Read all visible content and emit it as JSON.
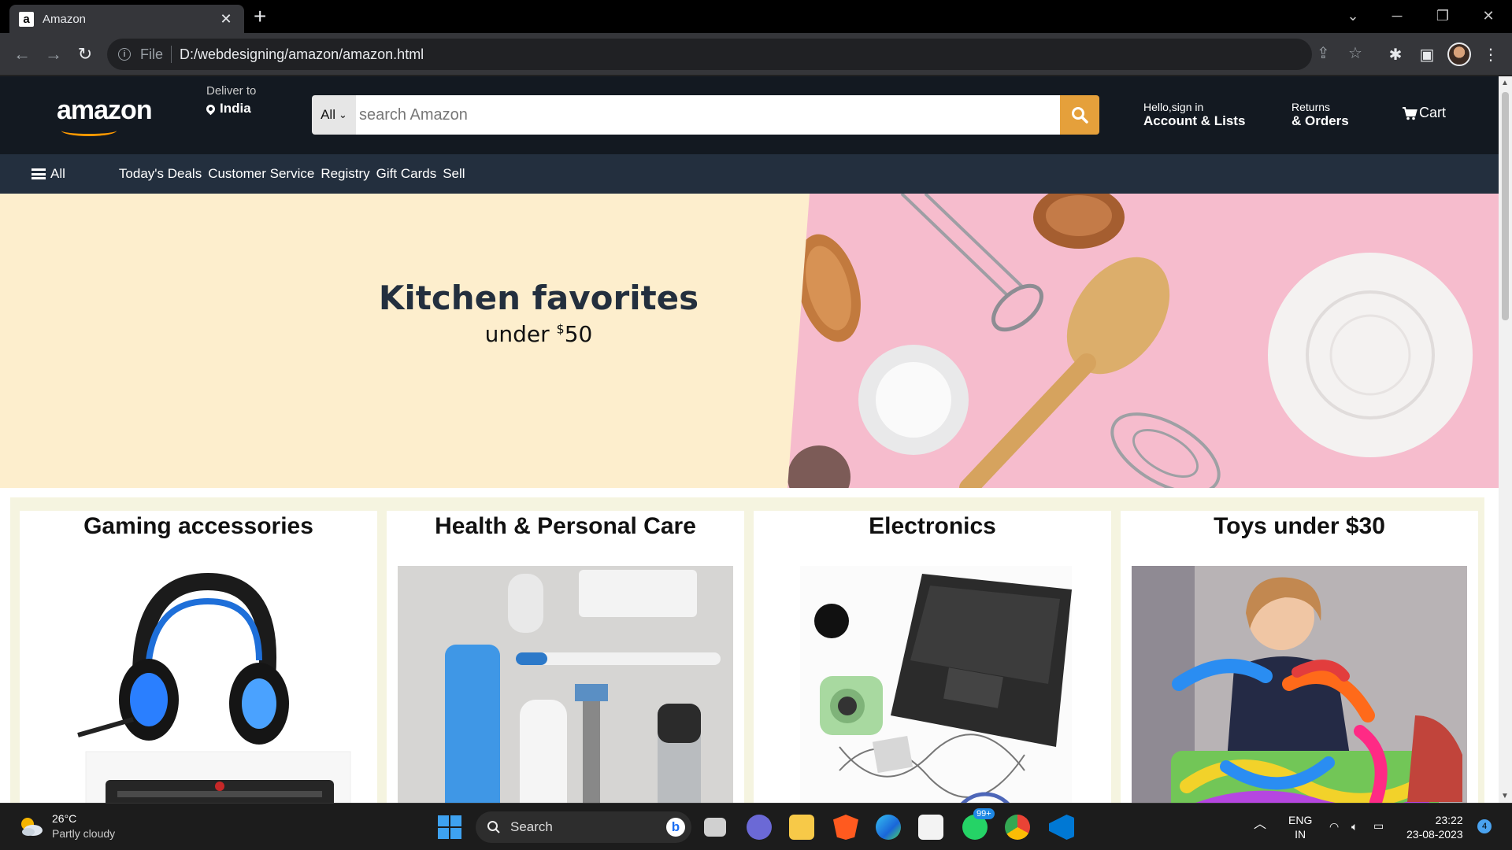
{
  "browser": {
    "tab_title": "Amazon",
    "favicon_letter": "a",
    "url_scheme": "File",
    "url": "D:/webdesigning/amazon/amazon.html"
  },
  "header": {
    "logo": "amazon",
    "deliver_label": "Deliver to",
    "deliver_country": "India",
    "search_category": "All",
    "search_placeholder": "search Amazon",
    "account_greeting": "Hello,sign in",
    "account_label": "Account & Lists",
    "returns_label": "Returns",
    "orders_label": "& Orders",
    "cart_label": "Cart"
  },
  "subnav": {
    "all_label": "All",
    "links": [
      "Today's Deals",
      "Customer Service",
      "Registry",
      "Gift Cards",
      "Sell"
    ]
  },
  "hero": {
    "title": "Kitchen favorites",
    "subtitle_prefix": "under ",
    "subtitle_currency": "$",
    "subtitle_amount": "50"
  },
  "cards": [
    {
      "title": "Gaming accessories"
    },
    {
      "title": "Health & Personal Care"
    },
    {
      "title": "Electronics"
    },
    {
      "title": "Toys under $30"
    }
  ],
  "taskbar": {
    "temperature": "26°C",
    "weather": "Partly cloudy",
    "search_label": "Search",
    "whatsapp_badge": "99+",
    "language": "ENG",
    "region": "IN",
    "time": "23:22",
    "date": "23-08-2023",
    "notification_count": "4"
  },
  "colors": {
    "amazon_dark": "#131921",
    "amazon_nav": "#232f3e",
    "search_button": "#e5a03b",
    "hero_bg": "#fdeecd",
    "card_band": "#f5f4e0"
  }
}
